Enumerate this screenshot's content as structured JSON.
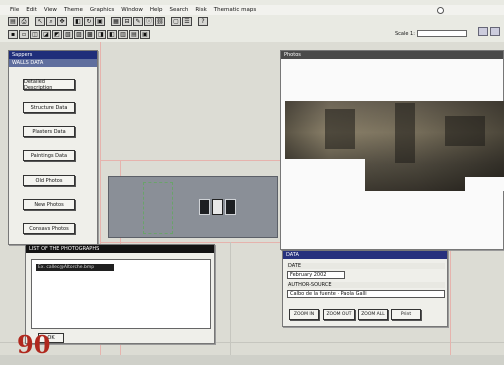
{
  "menubar": {
    "items": [
      "File",
      "Edit",
      "View",
      "Theme",
      "Graphics",
      "Window",
      "Help",
      "Search",
      "Risk",
      "Thematic maps"
    ]
  },
  "toolbar": {
    "scale_label": "Scale 1:",
    "scale_value": ""
  },
  "left_panel": {
    "title": "Sappers",
    "subtitle": "WALLS DATA",
    "buttons": [
      "Detailed Description",
      "Structure Data",
      "Plasters Data",
      "Paintings Data",
      "Old Photos",
      "New Photos",
      "Consavs Photos"
    ]
  },
  "list_window": {
    "title": "LIST OF THE PHOTOGRAPHS",
    "items": [
      "Ex. callec@Altorche.bmp"
    ],
    "ok_label": "OK"
  },
  "photos_window": {
    "title": "Photos"
  },
  "data_window": {
    "title": "DATA",
    "date_label": "DATE",
    "date_value": "February 2002",
    "author_label": "AUTHOR-SOURCE",
    "author_value": "Calbo de la fuente · Paola Galli",
    "buttons": [
      "ZOOM IN",
      "ZOOM OUT",
      "ZOOM ALL",
      "Print"
    ]
  },
  "page_number": "90",
  "colors": {
    "title_blue": "#27317d",
    "page_number_red": "#b0281e"
  }
}
